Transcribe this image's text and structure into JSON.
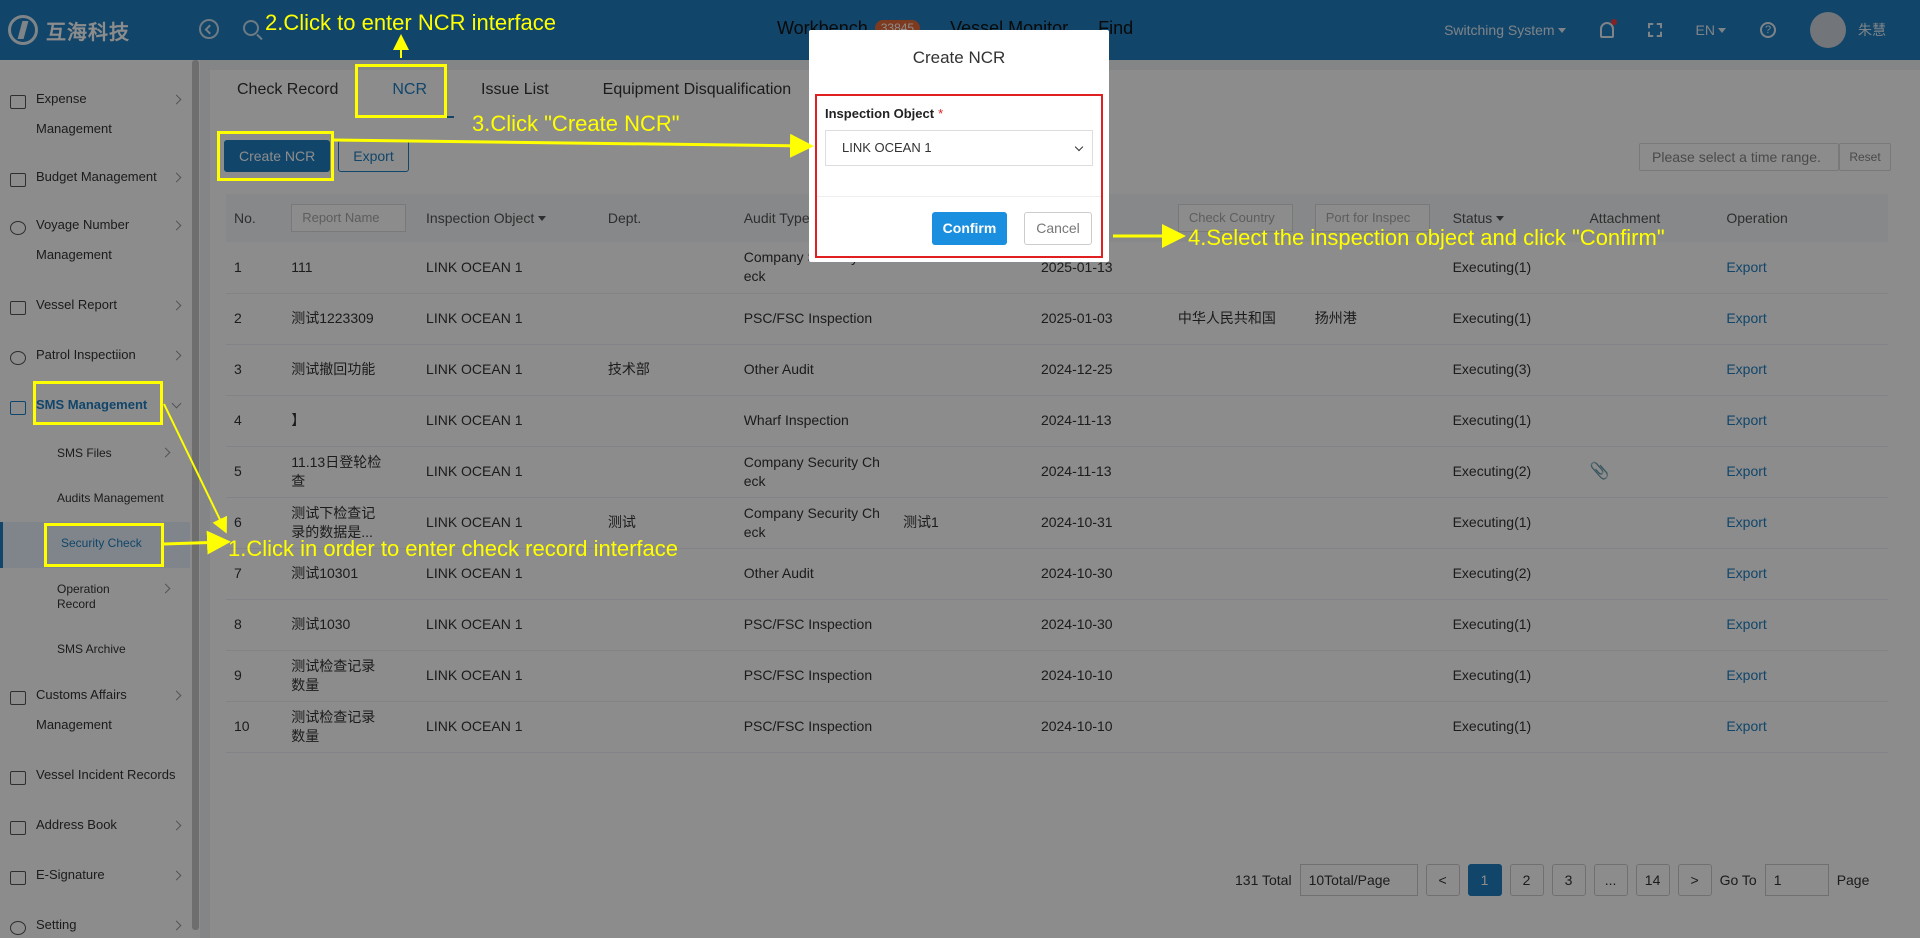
{
  "header": {
    "logo_text": "互海科技",
    "nav": [
      {
        "label": "Workbench",
        "badge": "33845"
      },
      {
        "label": "Vessel Monitor",
        "badge": ""
      },
      {
        "label": "Find",
        "badge": ""
      }
    ],
    "switching": "Switching System",
    "lang": "EN",
    "user": "朱慧"
  },
  "sidebar": {
    "items": [
      {
        "label": "Expense",
        "label2": "Management",
        "icon": "database-icon"
      },
      {
        "label": "Budget Management",
        "label2": "",
        "icon": "grid-icon"
      },
      {
        "label": "Voyage Number",
        "label2": "Management",
        "icon": "globe-icon"
      },
      {
        "label": "Vessel Report",
        "label2": "",
        "icon": "calendar-icon"
      },
      {
        "label": "Patrol Inspectiion",
        "label2": "",
        "icon": "check-circle-icon"
      },
      {
        "label": "SMS Management",
        "label2": "",
        "icon": "document-icon"
      },
      {
        "label": "Customs Affairs",
        "label2": "Management",
        "icon": "customs-icon"
      },
      {
        "label": "Vessel Incident Records",
        "label2": "",
        "icon": "warning-icon"
      },
      {
        "label": "Address Book",
        "label2": "",
        "icon": "book-icon"
      },
      {
        "label": "E-Signature",
        "label2": "",
        "icon": "stamp-icon"
      },
      {
        "label": "Setting",
        "label2": "",
        "icon": "gear-icon"
      }
    ],
    "sub": [
      "SMS Files",
      "Audits Management",
      "Security Check",
      "Operation",
      "Record",
      "SMS Archive"
    ]
  },
  "tabs": [
    "Check Record",
    "NCR",
    "Issue List",
    "Equipment Disqualification"
  ],
  "toolbar": {
    "create": "Create NCR",
    "export": "Export",
    "range": "Please select a time range.",
    "reset": "Reset"
  },
  "table": {
    "headers": {
      "no": "No.",
      "report": "Report Name",
      "object": "Inspection Object",
      "dept": "Dept.",
      "audit": "Audit Type",
      "country": "Check Country",
      "port": "Port for Inspec",
      "status": "Status",
      "attach": "Attachment",
      "op": "Operation"
    },
    "rows": [
      {
        "no": "1",
        "name": "111",
        "obj": "LINK OCEAN 1",
        "dept": "",
        "audit": "Company Security Ch",
        "audit2": "eck",
        "extra": "",
        "date": "2025-01-13",
        "country": "",
        "port": "",
        "status": "Executing(1)",
        "attach": "",
        "op": "Export"
      },
      {
        "no": "2",
        "name": "测试1223309",
        "obj": "LINK OCEAN 1",
        "dept": "",
        "audit": "PSC/FSC Inspection",
        "audit2": "",
        "extra": "",
        "date": "2025-01-03",
        "country": "中华人民共和国",
        "port": "扬州港",
        "status": "Executing(1)",
        "attach": "",
        "op": "Export"
      },
      {
        "no": "3",
        "name": "测试撤回功能",
        "obj": "LINK OCEAN 1",
        "dept": "技术部",
        "audit": "Other Audit",
        "audit2": "",
        "extra": "",
        "date": "2024-12-25",
        "country": "",
        "port": "",
        "status": "Executing(3)",
        "attach": "",
        "op": "Export"
      },
      {
        "no": "4",
        "name": "】",
        "obj": "LINK OCEAN 1",
        "dept": "",
        "audit": "Wharf Inspection",
        "audit2": "",
        "extra": "",
        "date": "2024-11-13",
        "country": "",
        "port": "",
        "status": "Executing(1)",
        "attach": "",
        "op": "Export"
      },
      {
        "no": "5",
        "name": "11.13日登轮检",
        "name2": "查",
        "obj": "LINK OCEAN 1",
        "dept": "",
        "audit": "Company Security Ch",
        "audit2": "eck",
        "extra": "",
        "date": "2024-11-13",
        "country": "",
        "port": "",
        "status": "Executing(2)",
        "attach": "📎",
        "op": "Export"
      },
      {
        "no": "6",
        "name": "测试下检查记",
        "name2": "录的数据是...",
        "obj": "LINK OCEAN 1",
        "dept": "测试",
        "audit": "Company Security Ch",
        "audit2": "eck",
        "extra": "测试1",
        "date": "2024-10-31",
        "country": "",
        "port": "",
        "status": "Executing(1)",
        "attach": "",
        "op": "Export"
      },
      {
        "no": "7",
        "name": "测试10301",
        "obj": "LINK OCEAN 1",
        "dept": "",
        "audit": "Other Audit",
        "audit2": "",
        "extra": "",
        "date": "2024-10-30",
        "country": "",
        "port": "",
        "status": "Executing(2)",
        "attach": "",
        "op": "Export"
      },
      {
        "no": "8",
        "name": "测试1030",
        "obj": "LINK OCEAN 1",
        "dept": "",
        "audit": "PSC/FSC Inspection",
        "audit2": "",
        "extra": "",
        "date": "2024-10-30",
        "country": "",
        "port": "",
        "status": "Executing(1)",
        "attach": "",
        "op": "Export"
      },
      {
        "no": "9",
        "name": "测试检查记录",
        "name2": "数量",
        "obj": "LINK OCEAN 1",
        "dept": "",
        "audit": "PSC/FSC Inspection",
        "audit2": "",
        "extra": "",
        "date": "2024-10-10",
        "country": "",
        "port": "",
        "status": "Executing(1)",
        "attach": "",
        "op": "Export"
      },
      {
        "no": "10",
        "name": "测试检查记录",
        "name2": "数量",
        "obj": "LINK OCEAN 1",
        "dept": "",
        "audit": "PSC/FSC Inspection",
        "audit2": "",
        "extra": "",
        "date": "2024-10-10",
        "country": "",
        "port": "",
        "status": "Executing(1)",
        "attach": "",
        "op": "Export"
      }
    ]
  },
  "pager": {
    "total": "131 Total",
    "size": "10Total/Page",
    "pages": [
      "1",
      "2",
      "3",
      "...",
      "14"
    ],
    "prev": "<",
    "next": ">",
    "goto": "Go To",
    "goto_val": "1",
    "page_word": "Page"
  },
  "modal": {
    "title": "Create NCR",
    "label": "Inspection Object",
    "required": "*",
    "value": "LINK OCEAN 1",
    "confirm": "Confirm",
    "cancel": "Cancel"
  },
  "annotations": {
    "a1": "1.Click in order to enter check record interface",
    "a2": "2.Click to enter NCR interface",
    "a3": "3.Click \"Create NCR\"",
    "a4": "4.Select the inspection object and click \"Confirm\""
  },
  "colors": {
    "brand": "#1f7fc1",
    "annotation": "#ffff00",
    "frame": "#e02020"
  }
}
